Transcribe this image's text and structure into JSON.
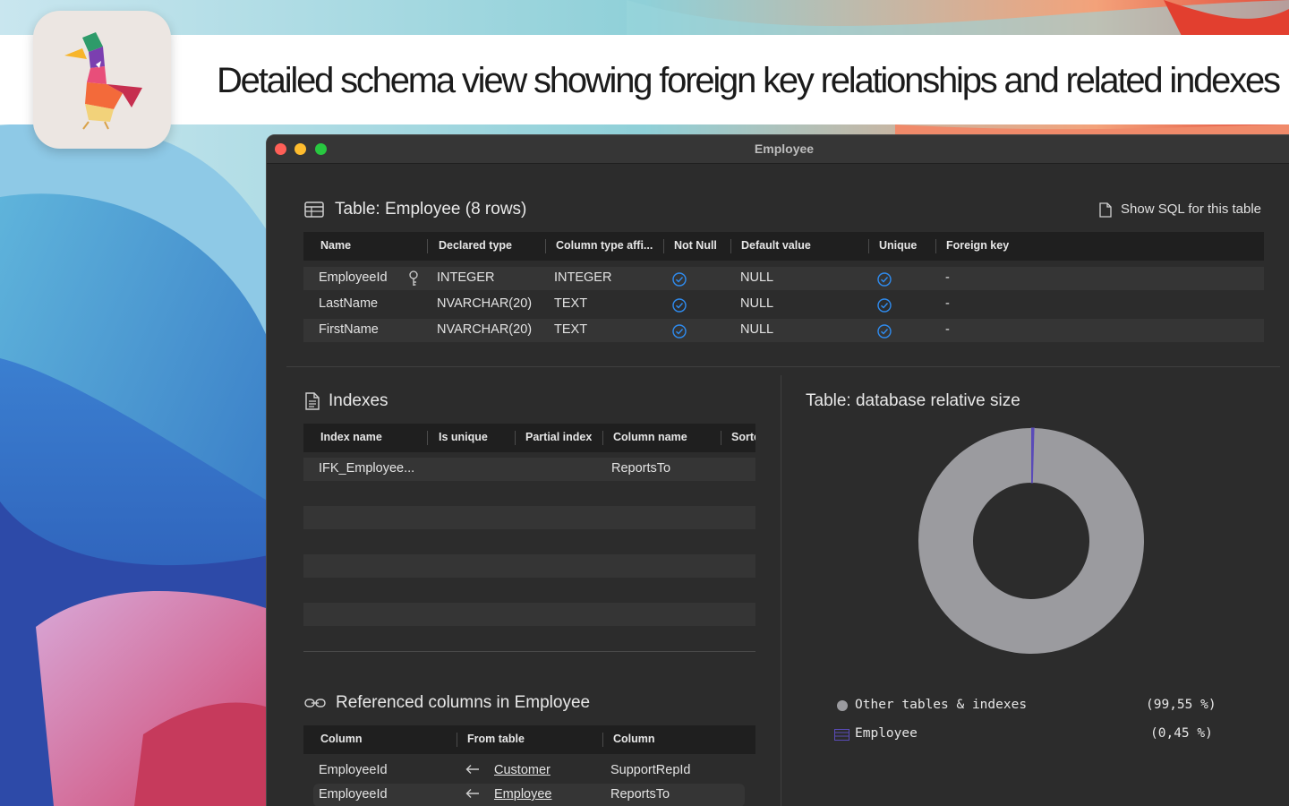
{
  "banner": {
    "title": "Detailed schema view showing foreign key relationships and related indexes",
    "app_icon": "duck-logo-icon"
  },
  "window": {
    "title": "Employee",
    "show_sql_label": "Show SQL for this table"
  },
  "schema": {
    "title": "Table: Employee (8 rows)",
    "columns": [
      "Name",
      "Declared type",
      "Column type affi...",
      "Not Null",
      "Default value",
      "Unique",
      "Foreign key"
    ],
    "rows": [
      {
        "name": "EmployeeId",
        "declared": "INTEGER",
        "affinity": "INTEGER",
        "not_null": true,
        "default": "NULL",
        "unique": true,
        "fk": "-",
        "primary_key": true
      },
      {
        "name": "LastName",
        "declared": "NVARCHAR(20)",
        "affinity": "TEXT",
        "not_null": true,
        "default": "NULL",
        "unique": true,
        "fk": "-"
      },
      {
        "name": "FirstName",
        "declared": "NVARCHAR(20)",
        "affinity": "TEXT",
        "not_null": true,
        "default": "NULL",
        "unique": true,
        "fk": "-"
      }
    ]
  },
  "indexes": {
    "title": "Indexes",
    "columns": [
      "Index name",
      "Is unique",
      "Partial index",
      "Column name",
      "Sorte"
    ],
    "rows": [
      {
        "index_name": "IFK_Employee...",
        "is_unique": "",
        "partial": "",
        "column": "ReportsTo",
        "sort": ""
      }
    ]
  },
  "referenced": {
    "title": "Referenced columns in Employee",
    "columns": [
      "Column",
      "From table",
      "Column"
    ],
    "rows": [
      {
        "column": "EmployeeId",
        "from_table": "Customer",
        "from_column": "SupportRepId"
      },
      {
        "column": "EmployeeId",
        "from_table": "Employee",
        "from_column": "ReportsTo"
      }
    ]
  },
  "size_chart": {
    "title": "Table: database relative size",
    "legend": [
      {
        "label": "Other tables & indexes",
        "pct": "(99,55 %)",
        "color": "#9b9b9f"
      },
      {
        "label": "Employee",
        "pct": "(0,45 %)",
        "color": "#5a4bb8"
      }
    ]
  },
  "chart_data": {
    "type": "pie",
    "title": "Table: database relative size",
    "categories": [
      "Other tables & indexes",
      "Employee"
    ],
    "values": [
      99.55,
      0.45
    ],
    "colors": [
      "#9b9b9f",
      "#5a4bb8"
    ],
    "legend": "bottom"
  }
}
